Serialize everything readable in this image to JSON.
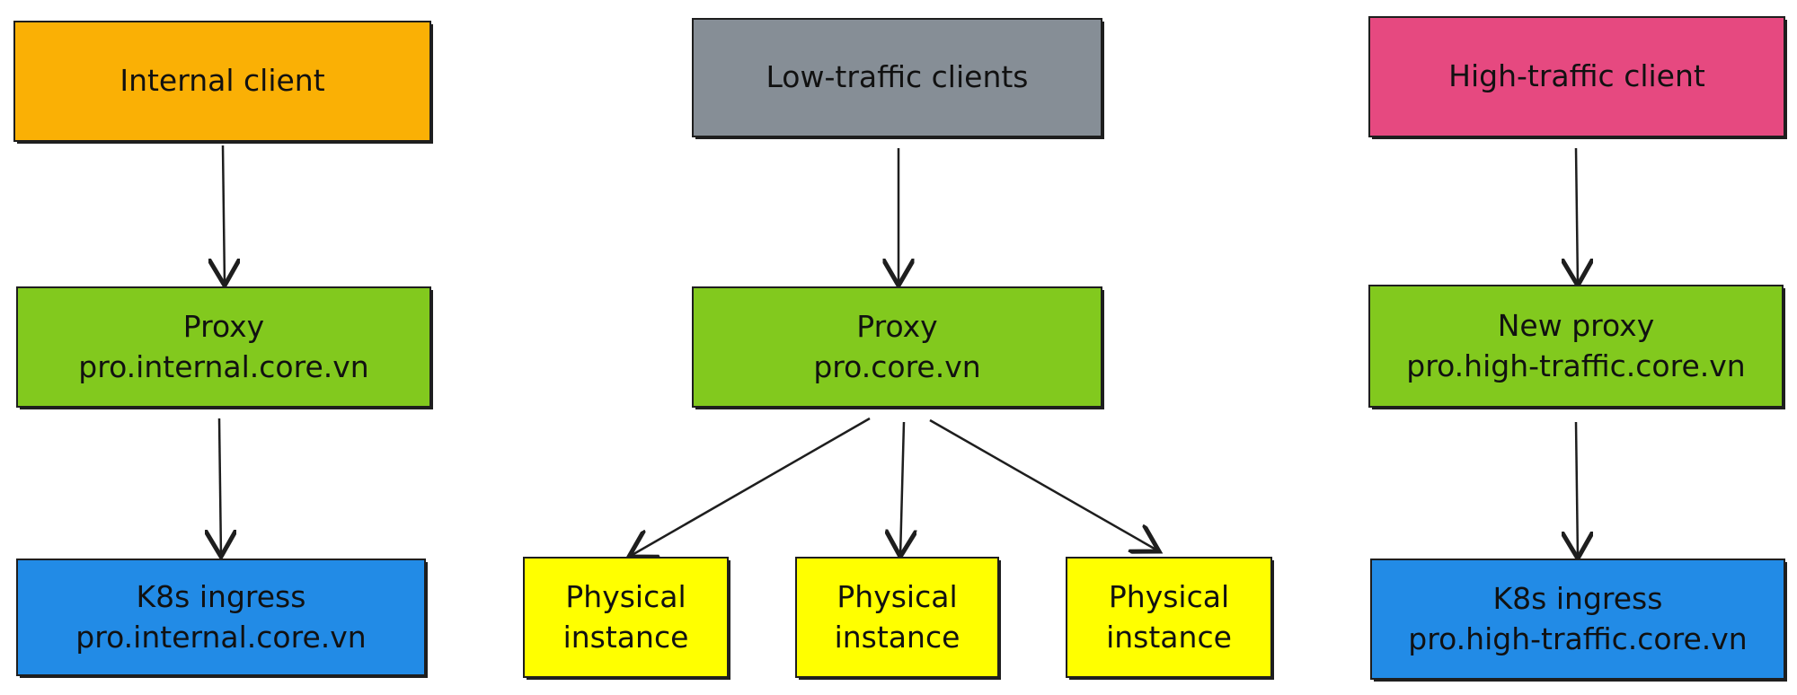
{
  "colors": {
    "internal": "#fab005",
    "low": "#868e96",
    "high": "#e64980",
    "proxy": "#82c91e",
    "k8s": "#228be6",
    "physical": "#ffff00"
  },
  "columns": [
    {
      "client": "Internal client",
      "proxy": [
        "Proxy",
        "pro.internal.core.vn"
      ],
      "backend": [
        "K8s ingress",
        "pro.internal.core.vn"
      ]
    },
    {
      "client": "Low-traffic clients",
      "proxy": [
        "Proxy",
        "pro.core.vn"
      ],
      "physical": [
        [
          "Physical",
          "instance"
        ],
        [
          "Physical",
          "instance"
        ],
        [
          "Physical",
          "instance"
        ]
      ]
    },
    {
      "client": "High-traffic client",
      "proxy": [
        "New proxy",
        "pro.high-traffic.core.vn"
      ],
      "backend": [
        "K8s ingress",
        "pro.high-traffic.core.vn"
      ]
    }
  ]
}
